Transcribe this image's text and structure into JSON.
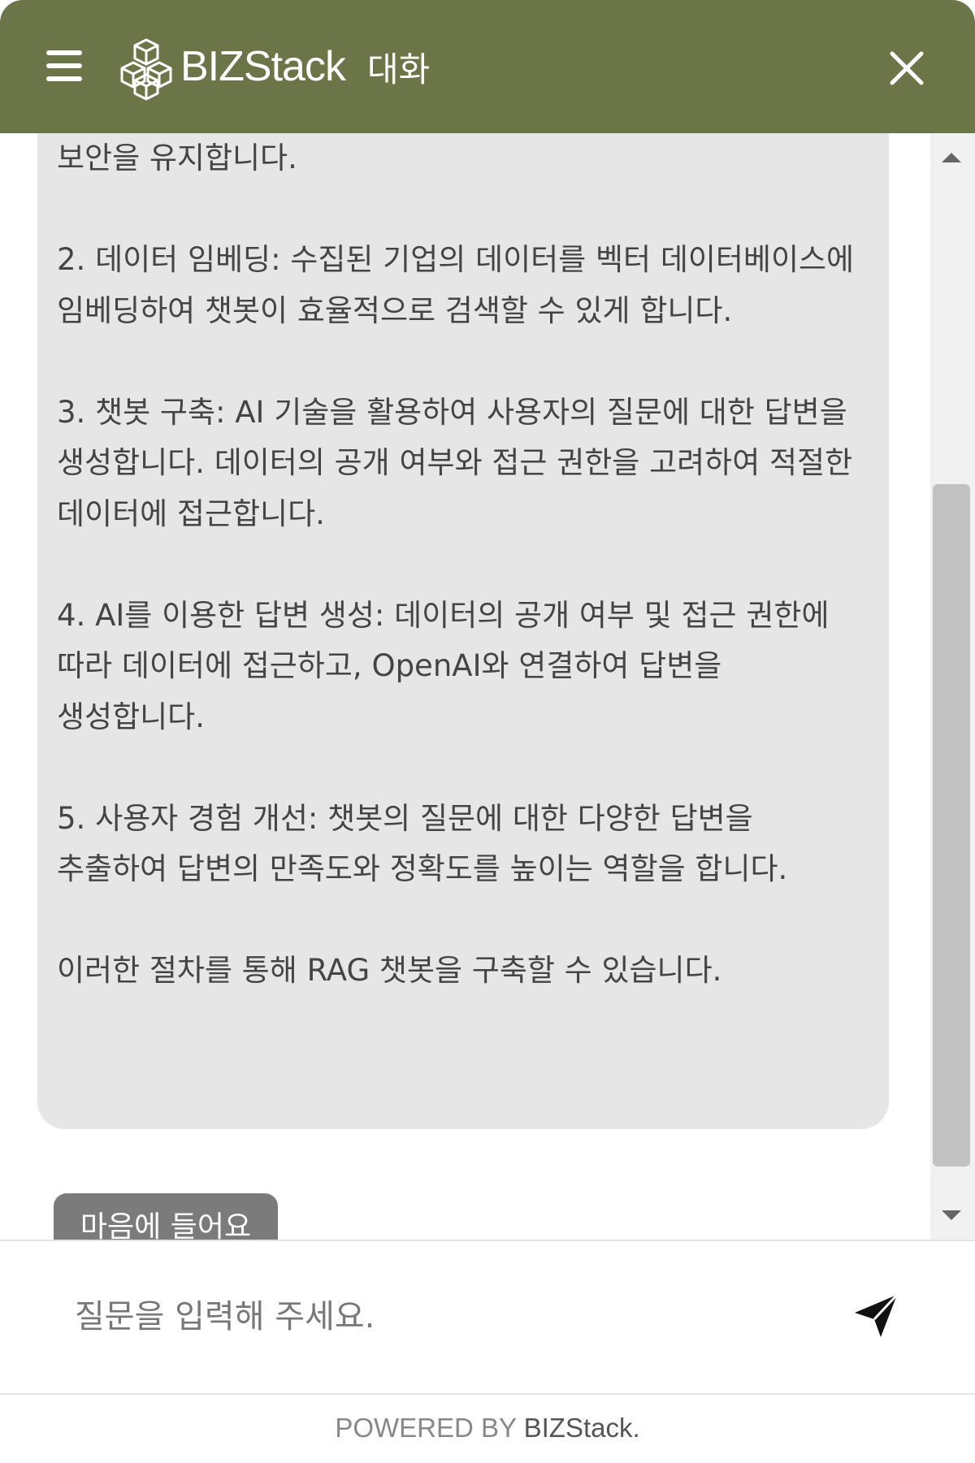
{
  "header": {
    "brand": "BIZStack",
    "subtitle": "대화",
    "accent_color": "#6b7547",
    "menu_icon": "hamburger-menu-icon",
    "logo_icon": "cubes-logo-icon",
    "close_icon": "close-icon"
  },
  "message": {
    "role": "bot",
    "text": "보안을 유지합니다.\n\n2. 데이터 임베딩: 수집된 기업의 데이터를 벡터 데이터베이스에 임베딩하여 챗봇이 효율적으로 검색할 수 있게 합니다.\n\n3. 챗봇 구축: AI 기술을 활용하여 사용자의 질문에 대한 답변을 생성합니다. 데이터의 공개 여부와 접근 권한을 고려하여 적절한 데이터에 접근합니다.\n\n4. AI를 이용한 답변 생성: 데이터의 공개 여부 및 접근 권한에 따라 데이터에 접근하고, OpenAI와 연결하여 답변을 생성합니다.\n\n5. 사용자 경험 개선: 챗봇의 질문에 대한 다양한 답변을 추출하여 답변의 만족도와 정확도를 높이는 역할을 합니다.\n\n이러한 절차를 통해 RAG 챗봇을 구축할 수 있습니다.",
    "bubble_color": "#e6e6e6"
  },
  "tooltip": {
    "text": "마음에 들어요"
  },
  "actions": {
    "copy_icon": "copy-icon",
    "like_icon": "thumbs-up-icon",
    "dislike_icon": "thumbs-down-icon"
  },
  "input": {
    "placeholder": "질문을 입력해 주세요.",
    "value": "",
    "send_icon": "send-paper-plane-icon"
  },
  "footer": {
    "prefix": "POWERED BY ",
    "brand": "BIZStack."
  }
}
